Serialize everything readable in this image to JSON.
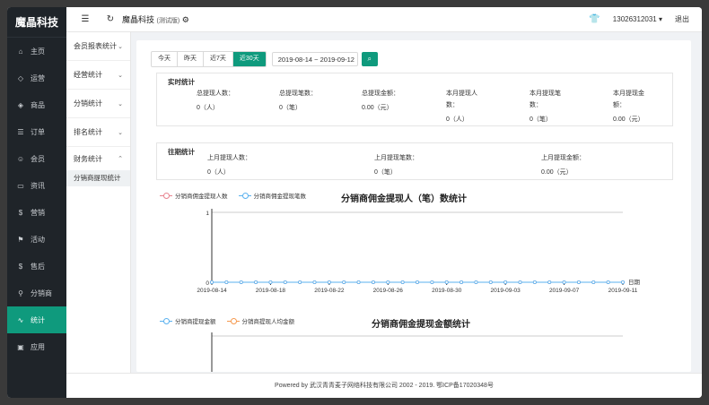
{
  "app": {
    "brand": "魔晶科技"
  },
  "sidebar": {
    "items": [
      {
        "label": "主页",
        "icon": "home-icon",
        "glyph": "⌂"
      },
      {
        "label": "运营",
        "icon": "shield-icon",
        "glyph": "◇"
      },
      {
        "label": "商品",
        "icon": "tag-icon",
        "glyph": "◈"
      },
      {
        "label": "订单",
        "icon": "list-icon",
        "glyph": "☰"
      },
      {
        "label": "会员",
        "icon": "user-circle-icon",
        "glyph": "☺"
      },
      {
        "label": "资讯",
        "icon": "news-icon",
        "glyph": "▭"
      },
      {
        "label": "营销",
        "icon": "coin-icon",
        "glyph": "$"
      },
      {
        "label": "活动",
        "icon": "flag-icon",
        "glyph": "⚑"
      },
      {
        "label": "售后",
        "icon": "service-icon",
        "glyph": "$"
      },
      {
        "label": "分销商",
        "icon": "person-icon",
        "glyph": "⚲"
      },
      {
        "label": "统计",
        "icon": "chart-icon",
        "glyph": "∿",
        "active": true
      },
      {
        "label": "应用",
        "icon": "apps-icon",
        "glyph": "▣"
      }
    ]
  },
  "topbar": {
    "title": "魔晶科技",
    "title_note": "(测试版)",
    "account": "13026312031",
    "logout": "退出"
  },
  "subnav": {
    "groups": [
      "会员报表统计",
      "经营统计",
      "分销统计",
      "排名统计"
    ],
    "open_group": "财务统计",
    "active_leaf": "分销商提现统计"
  },
  "filters": {
    "ranges": [
      "今天",
      "昨天",
      "近7天",
      "近30天"
    ],
    "active_range": "近30天",
    "date_range": "2019-08-14 ~ 2019-09-12"
  },
  "realtime": {
    "title": "实时统计",
    "cells": [
      {
        "label": "总提现人数：",
        "value": "0（人）"
      },
      {
        "label": "总提现笔数：",
        "value": "0（笔）"
      },
      {
        "label": "总提现金额：",
        "value": "0.00（元）"
      },
      {
        "label": "本月提现人数：",
        "value": "0（人）"
      },
      {
        "label": "本月提现笔数：",
        "value": "0（笔）"
      },
      {
        "label": "本月提现金额：",
        "value": "0.00（元）"
      }
    ]
  },
  "history": {
    "title": "往期统计",
    "cells": [
      {
        "label": "上月提现人数：",
        "value": "0（人）"
      },
      {
        "label": "上月提现笔数：",
        "value": "0（笔）"
      },
      {
        "label": "上月提现金额：",
        "value": "0.00（元）"
      }
    ]
  },
  "chart_data": [
    {
      "type": "line",
      "title": "分销商佣金提现人（笔）数统计",
      "xlabel": "日期",
      "ylabel": "",
      "ylim": [
        0,
        1
      ],
      "y_ticks": [
        "0",
        "1"
      ],
      "x_tick_labels": [
        "2019-08-14",
        "2019-08-18",
        "2019-08-22",
        "2019-08-26",
        "2019-08-30",
        "2019-09-03",
        "2019-09-07",
        "2019-09-11"
      ],
      "x": [
        "2019-08-14",
        "2019-08-15",
        "2019-08-16",
        "2019-08-17",
        "2019-08-18",
        "2019-08-19",
        "2019-08-20",
        "2019-08-21",
        "2019-08-22",
        "2019-08-23",
        "2019-08-24",
        "2019-08-25",
        "2019-08-26",
        "2019-08-27",
        "2019-08-28",
        "2019-08-29",
        "2019-08-30",
        "2019-08-31",
        "2019-09-01",
        "2019-09-02",
        "2019-09-03",
        "2019-09-04",
        "2019-09-05",
        "2019-09-06",
        "2019-09-07",
        "2019-09-08",
        "2019-09-09",
        "2019-09-10",
        "2019-09-11"
      ],
      "legend_position": "top-left",
      "series": [
        {
          "name": "分销商佣金提现人数",
          "color": "#e8838f",
          "values": [
            0,
            0,
            0,
            0,
            0,
            0,
            0,
            0,
            0,
            0,
            0,
            0,
            0,
            0,
            0,
            0,
            0,
            0,
            0,
            0,
            0,
            0,
            0,
            0,
            0,
            0,
            0,
            0,
            0
          ]
        },
        {
          "name": "分销商佣金提现笔数",
          "color": "#5ab1ef",
          "values": [
            0,
            0,
            0,
            0,
            0,
            0,
            0,
            0,
            0,
            0,
            0,
            0,
            0,
            0,
            0,
            0,
            0,
            0,
            0,
            0,
            0,
            0,
            0,
            0,
            0,
            0,
            0,
            0,
            0
          ]
        }
      ]
    },
    {
      "type": "line",
      "title": "分销商佣金提现金额统计",
      "xlabel": "",
      "ylabel": "",
      "legend_position": "top-left",
      "series": [
        {
          "name": "分销商提现金额",
          "color": "#5ab1ef",
          "values": []
        },
        {
          "name": "分销商提现人均金额",
          "color": "#f5994e",
          "values": []
        }
      ]
    }
  ],
  "footer": {
    "text": "Powered by 武汉青青麦子网络科技有限公司 2002 - 2019. 鄂ICP备17020348号"
  }
}
